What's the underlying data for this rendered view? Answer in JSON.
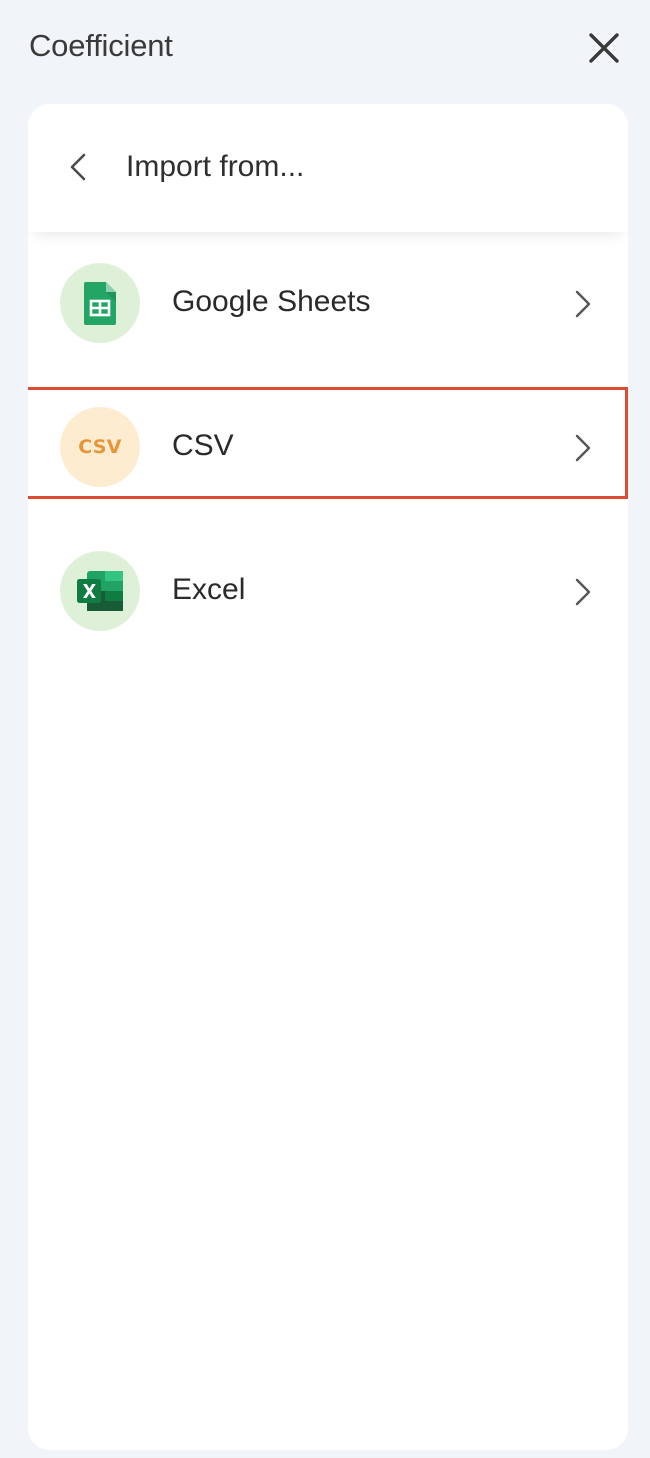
{
  "app": {
    "title": "Coefficient"
  },
  "panel": {
    "title": "Import from...",
    "back_icon": "chevron-left-icon",
    "close_icon": "close-icon"
  },
  "sources": [
    {
      "label": "Google Sheets",
      "icon": "google-sheets-icon",
      "icon_bg": "#dff0d8",
      "selected": false
    },
    {
      "label": "CSV",
      "icon": "csv-icon",
      "icon_text": "CSV",
      "icon_bg": "#fdecd0",
      "icon_color": "#e8953a",
      "selected": true
    },
    {
      "label": "Excel",
      "icon": "excel-icon",
      "icon_bg": "#dff0d8",
      "selected": false
    }
  ],
  "colors": {
    "background": "#f1f4f9",
    "card": "#ffffff",
    "highlight": "#de4a33"
  }
}
